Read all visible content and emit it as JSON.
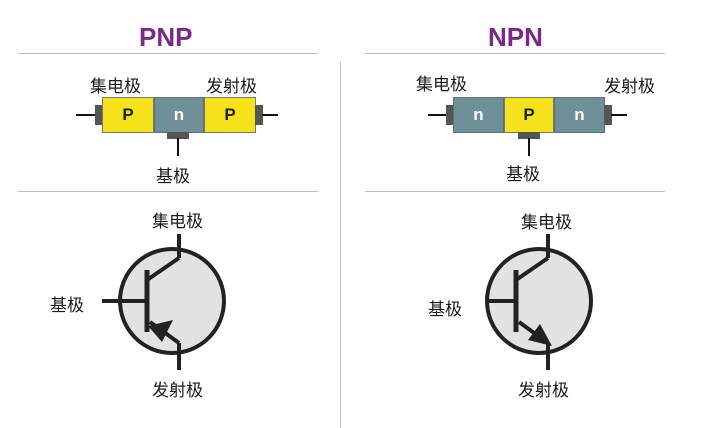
{
  "pnp": {
    "title": "PNP",
    "collector_label": "集电极",
    "emitter_label": "发射极",
    "base_label": "基极",
    "segments": [
      "P",
      "n",
      "P"
    ],
    "symbol": {
      "collector_label": "集电极",
      "base_label": "基极",
      "emitter_label": "发射极"
    }
  },
  "npn": {
    "title": "NPN",
    "collector_label": "集电极",
    "emitter_label": "发射极",
    "base_label": "基极",
    "segments": [
      "n",
      "P",
      "n"
    ],
    "symbol": {
      "collector_label": "集电极",
      "base_label": "基极",
      "emitter_label": "发射极"
    }
  },
  "colors": {
    "title": "#7a2a86",
    "p_region": "#f5e21a",
    "n_region": "#6f8f99",
    "symbol_fill": "#e2e2e2",
    "symbol_stroke": "#222222",
    "divider": "#bdbdbd"
  }
}
